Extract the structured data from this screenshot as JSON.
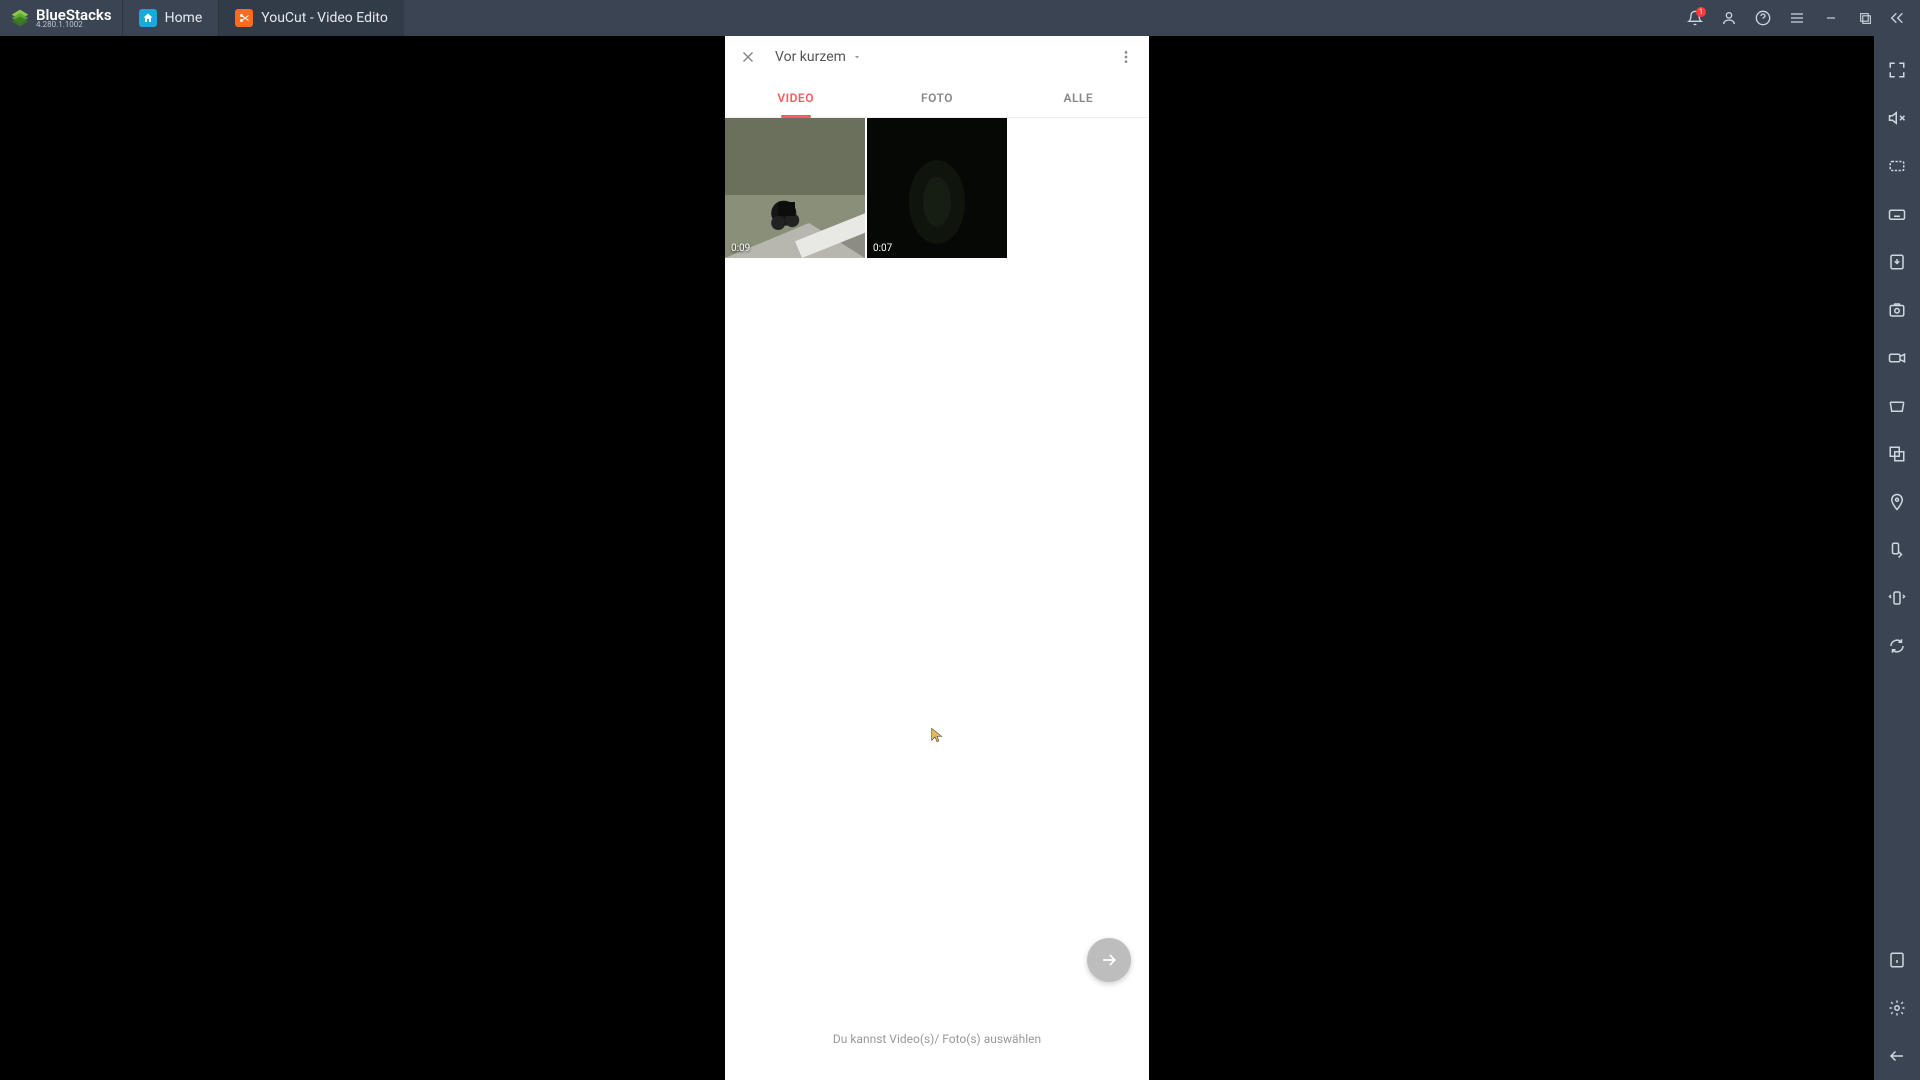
{
  "brand": {
    "name": "BlueStacks",
    "version": "4.280.1.1002"
  },
  "tabs": [
    {
      "label": "Home",
      "icon": "home"
    },
    {
      "label": "YouCut - Video Edito",
      "icon": "app",
      "active": true
    }
  ],
  "titlebar": {
    "notif_count": "1"
  },
  "app": {
    "header": {
      "title": "Vor kurzem"
    },
    "tabs": {
      "video": "VIDEO",
      "foto": "FOTO",
      "alle": "ALLE"
    },
    "thumbs": [
      {
        "duration": "0:09",
        "kind": "motorcycle"
      },
      {
        "duration": "0:07",
        "kind": "dark"
      }
    ],
    "hint": "Du kannst Video(s)/ Foto(s) auswählen"
  }
}
